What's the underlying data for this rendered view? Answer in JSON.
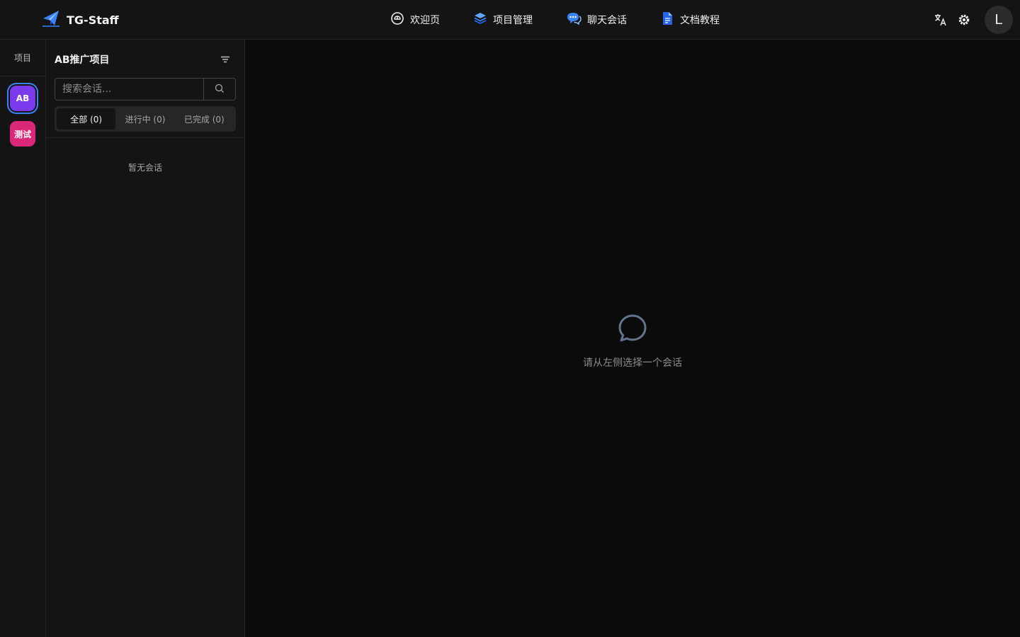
{
  "header": {
    "brand": "TG-Staff",
    "nav": [
      {
        "label": "欢迎页",
        "icon": "welcome-icon"
      },
      {
        "label": "项目管理",
        "icon": "layers-icon"
      },
      {
        "label": "聊天会话",
        "icon": "chat-bubbles-icon"
      },
      {
        "label": "文档教程",
        "icon": "document-icon"
      }
    ],
    "avatar_initial": "L"
  },
  "rail": {
    "label": "项目",
    "projects": [
      {
        "label": "AB",
        "color": "#7c3aed",
        "selected": true
      },
      {
        "label": "测试",
        "color": "#db2777",
        "selected": false
      }
    ]
  },
  "conversations": {
    "title": "AB推广项目",
    "search_placeholder": "搜索会话...",
    "tabs": [
      {
        "label": "全部 (0)",
        "active": true
      },
      {
        "label": "进行中 (0)",
        "active": false
      },
      {
        "label": "已完成 (0)",
        "active": false
      }
    ],
    "empty_text": "暂无会话"
  },
  "main": {
    "placeholder_text": "请从左侧选择一个会话"
  },
  "colors": {
    "accent": "#3b82f6",
    "background": "#0b0b0b",
    "panel": "#141414"
  }
}
